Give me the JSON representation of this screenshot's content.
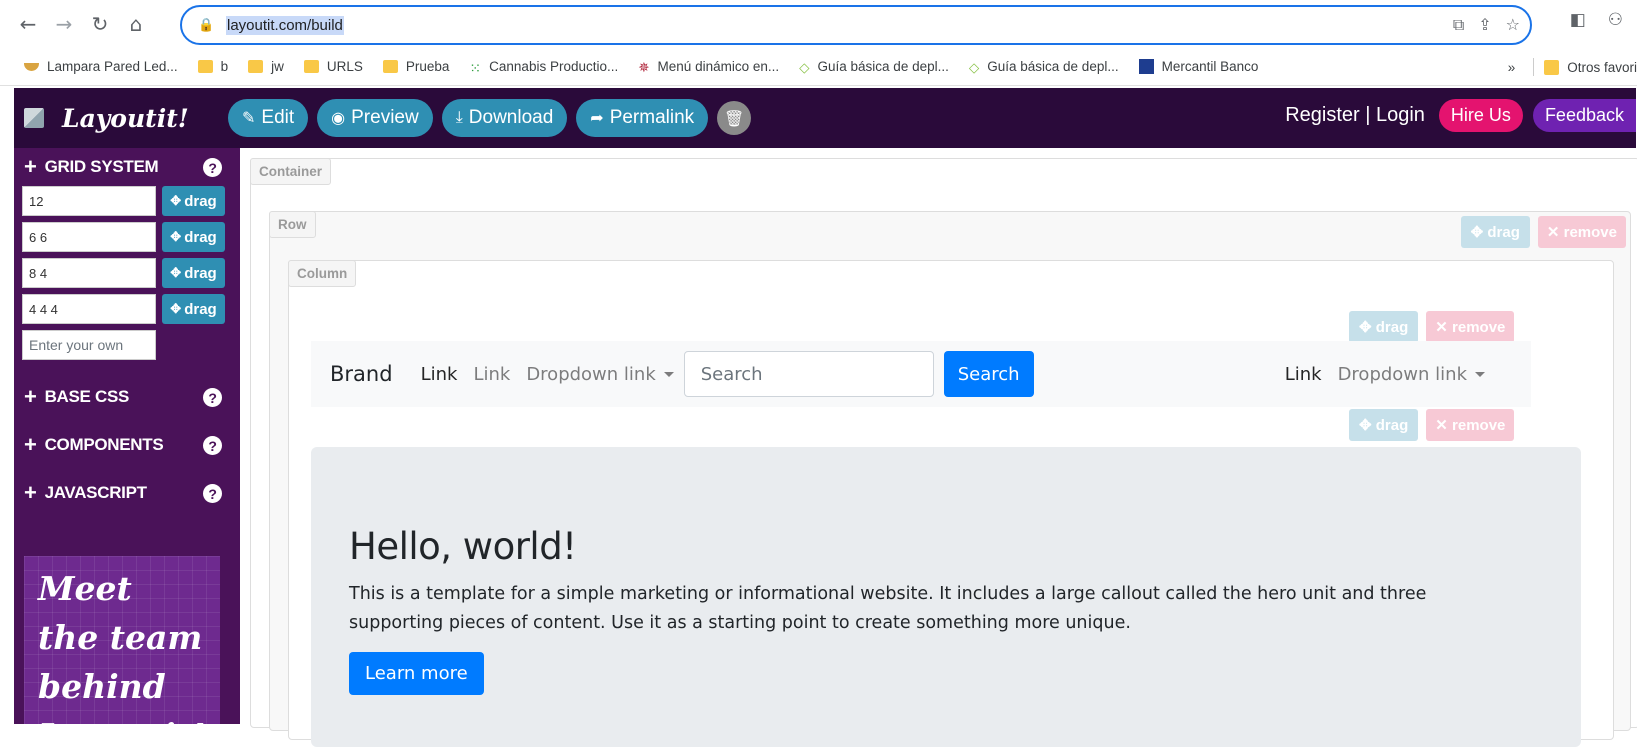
{
  "browser": {
    "url": "layoutit.com/build",
    "bookmarks": [
      {
        "label": "Lampara Pared Led...",
        "icon": "bowl-icon"
      },
      {
        "label": "b",
        "icon": "folder-icon"
      },
      {
        "label": "jw",
        "icon": "folder-icon"
      },
      {
        "label": "URLS",
        "icon": "folder-icon"
      },
      {
        "label": "Prueba",
        "icon": "folder-icon"
      },
      {
        "label": "Cannabis Productio...",
        "icon": "dots-icon"
      },
      {
        "label": "Menú dinámico en...",
        "icon": "star-burst-icon"
      },
      {
        "label": "Guía básica de depl...",
        "icon": "diamond-icon"
      },
      {
        "label": "Guía básica de depl...",
        "icon": "diamond-icon"
      },
      {
        "label": "Mercantil Banco",
        "icon": "bank-icon"
      }
    ],
    "more_label": "»",
    "other_bookmarks": "Otros favori"
  },
  "header": {
    "logo_text": "Layoutit!",
    "buttons": {
      "edit": "Edit",
      "preview": "Preview",
      "download": "Download",
      "permalink": "Permalink"
    },
    "register_login": "Register | Login",
    "hire_us": "Hire Us",
    "feedback": "Feedback"
  },
  "sidebar": {
    "grid_system": "GRID SYSTEM",
    "grid_rows": [
      "12",
      "6 6",
      "8 4",
      "4 4 4"
    ],
    "drag_label": "drag",
    "own_placeholder": "Enter your own",
    "base_css": "BASE CSS",
    "components": "COMPONENTS",
    "javascript": "JAVASCRIPT",
    "banner": [
      "Meet",
      "the team",
      "behind",
      "Layoutit!"
    ]
  },
  "canvas": {
    "container_label": "Container",
    "row_label": "Row",
    "column_label": "Column",
    "drag": "drag",
    "remove": "remove",
    "navbar": {
      "brand": "Brand",
      "link_active": "Link",
      "link": "Link",
      "dropdown": "Dropdown link",
      "search_placeholder": "Search",
      "search_button": "Search",
      "right_link": "Link",
      "right_dropdown": "Dropdown link"
    },
    "jumbotron": {
      "title": "Hello, world!",
      "text": "This is a template for a simple marketing or informational website. It includes a large callout called the hero unit and three supporting pieces of content. Use it as a starting point to create something more unique.",
      "button": "Learn more"
    }
  }
}
